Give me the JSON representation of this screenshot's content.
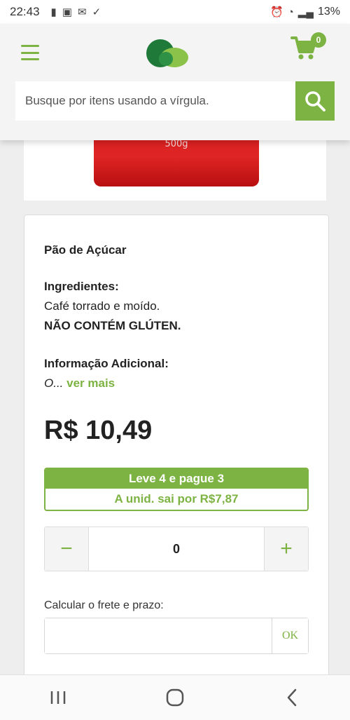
{
  "status_bar": {
    "time": "22:43",
    "battery": "13%"
  },
  "header": {
    "cart_count": "0",
    "search_placeholder": "Busque por itens usando a vírgula."
  },
  "product_image": {
    "weight_label": "500g"
  },
  "product": {
    "brand": "Pão de Açúcar",
    "ingredients_title": "Ingredientes:",
    "ingredients_text": "Café torrado e moído.",
    "gluten_warning": "NÃO CONTÉM GLÚTEN.",
    "additional_title": "Informação Adicional:",
    "additional_excerpt": "O...",
    "see_more": "ver mais",
    "price": "R$ 10,49"
  },
  "promo": {
    "headline": "Leve 4 e pague 3",
    "unit_price": "A unid. sai por R$7,87"
  },
  "quantity": {
    "minus": "−",
    "value": "0",
    "plus": "+"
  },
  "shipping": {
    "label": "Calcular o frete e prazo:",
    "input_value": "",
    "ok_label": "OK"
  },
  "colors": {
    "accent": "#7cb342",
    "background": "#eeeeee"
  }
}
